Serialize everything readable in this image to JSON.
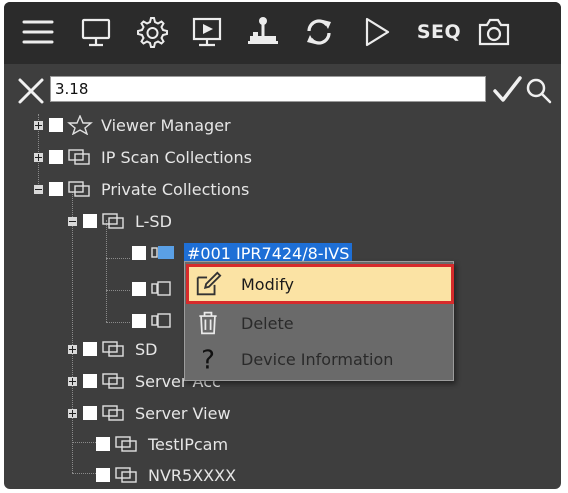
{
  "toolbar": {
    "seq_label": "SEQ"
  },
  "search": {
    "value": "3.18"
  },
  "tree": {
    "viewer_manager": "Viewer Manager",
    "ip_scan": "IP Scan Collections",
    "private": "Private Collections",
    "lsd": "L-SD",
    "device1": "#001 IPR7424/8-IVS",
    "sd": "SD",
    "server_acc": "Server Acc",
    "server_view": "Server View",
    "testipcam": "TestIPcam",
    "nvr": "NVR5XXXX"
  },
  "context_menu": {
    "modify": "Modify",
    "delete": "Delete",
    "device_info": "Device Information"
  }
}
